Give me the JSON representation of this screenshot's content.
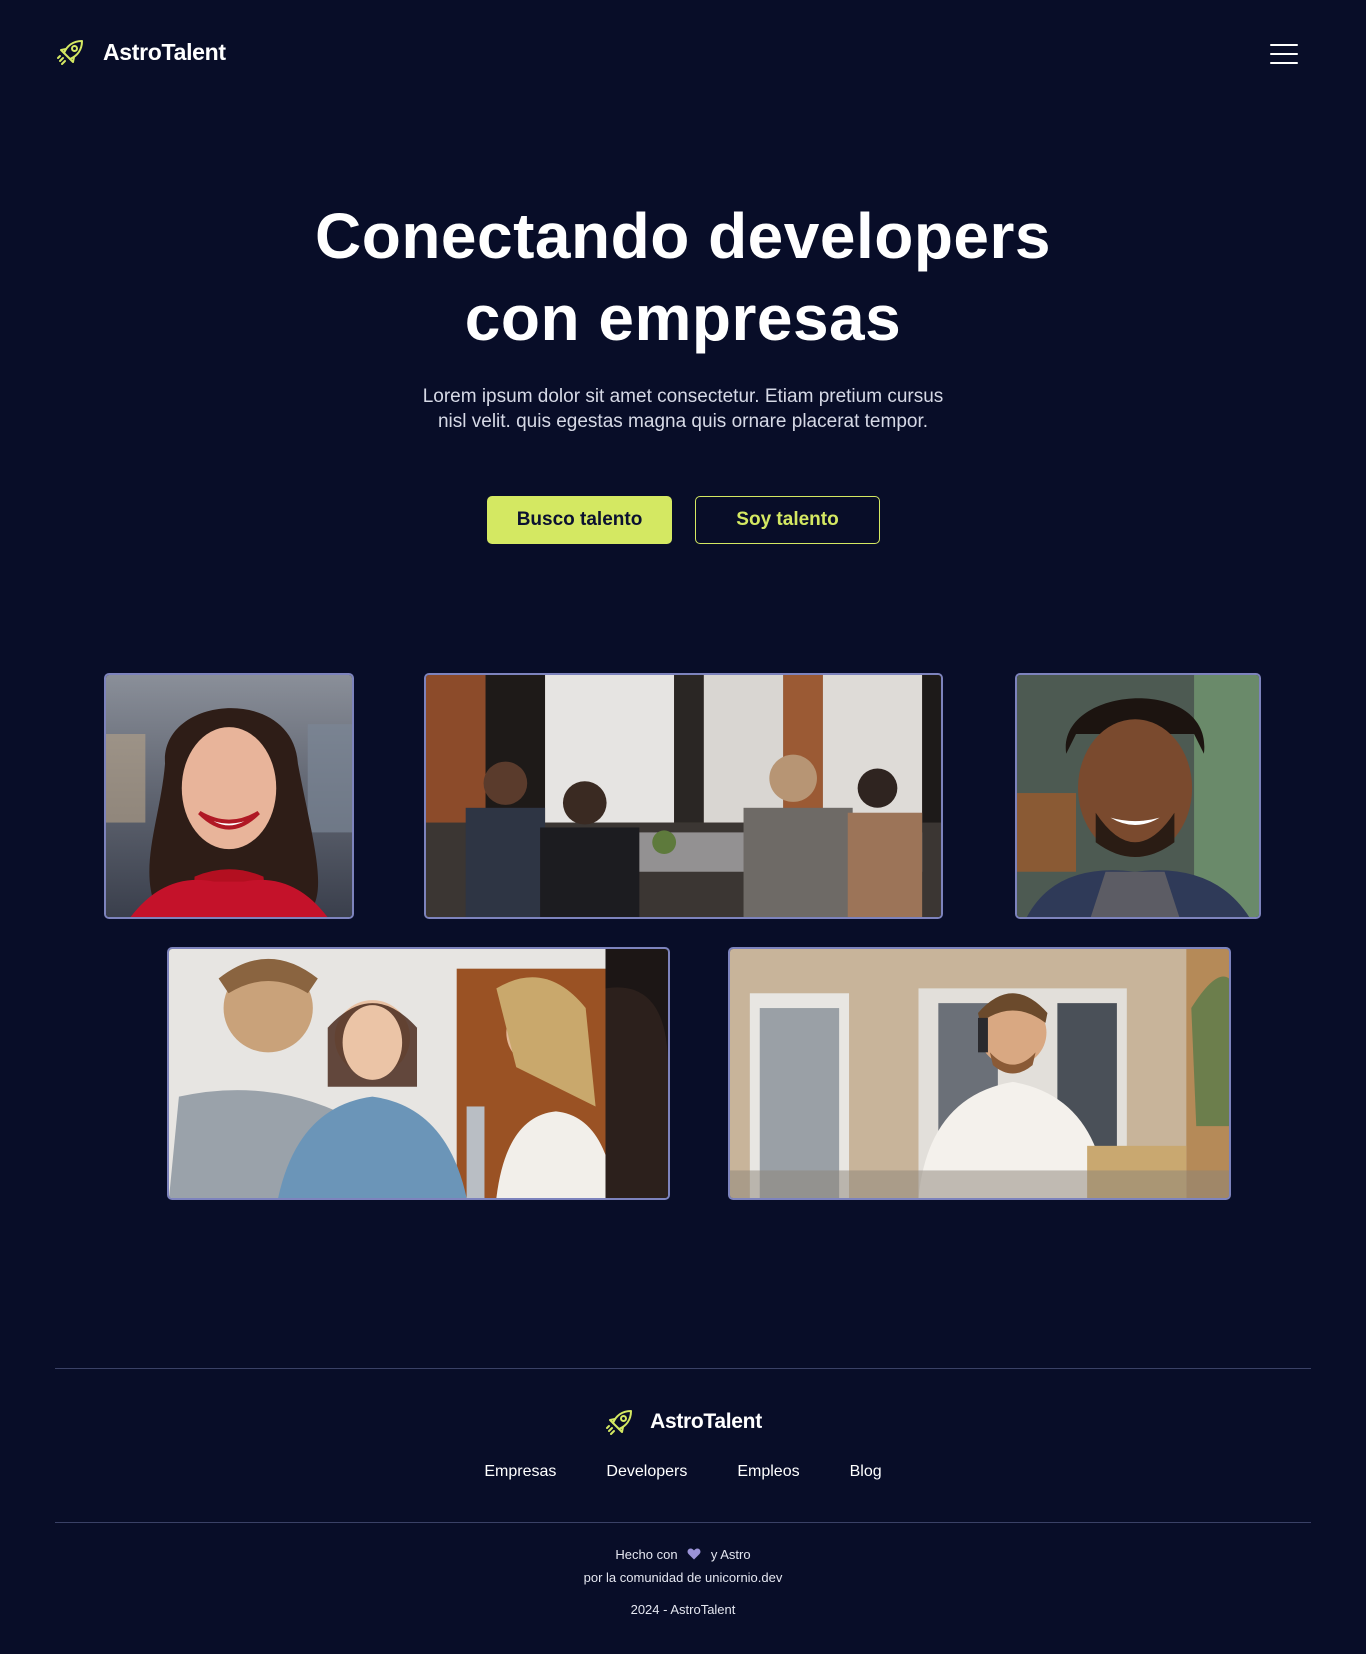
{
  "header": {
    "brand": "AstroTalent",
    "logo_icon": "rocket-icon",
    "menu_icon": "hamburger-menu-icon"
  },
  "hero": {
    "title_line1": "Conectando developers",
    "title_line2": "con empresas",
    "subtitle_line1": "Lorem ipsum dolor sit amet consectetur. Etiam pretium cursus",
    "subtitle_line2": "nisl velit. quis egestas magna quis ornare placerat tempor.",
    "primary_cta": "Busco talento",
    "secondary_cta": "Soy talento"
  },
  "gallery": {
    "photos": [
      "smiling-woman-photo",
      "team-working-photo",
      "smiling-man-photo",
      "group-laughing-photo",
      "man-on-phone-photo"
    ]
  },
  "footer": {
    "brand": "AstroTalent",
    "nav": [
      "Empresas",
      "Developers",
      "Empleos",
      "Blog"
    ],
    "made_with_prefix": "Hecho con",
    "made_with_suffix": "y Astro",
    "community": "por la comunidad de unicornio.dev",
    "copyright": "2024 - AstroTalent"
  },
  "colors": {
    "background": "#080d28",
    "accent": "#d4e862",
    "photo_border": "#7d83bd",
    "heart": "#9b93d8"
  }
}
